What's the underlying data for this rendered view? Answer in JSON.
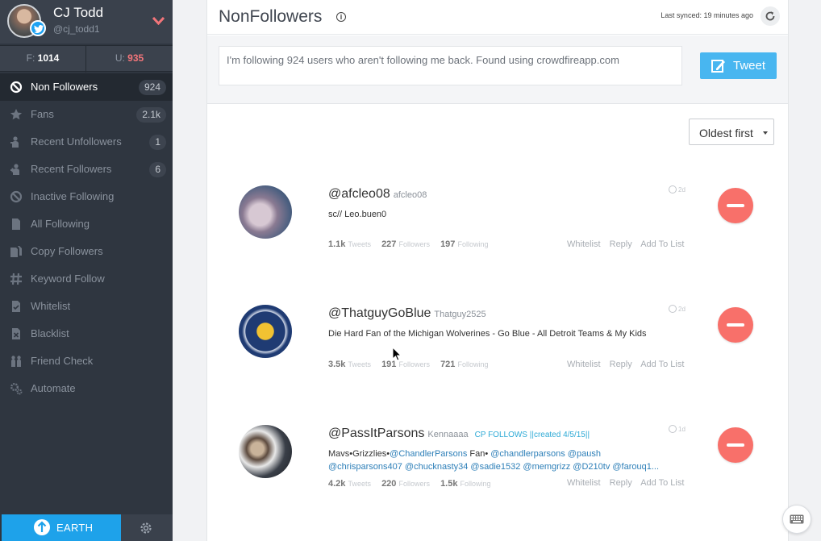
{
  "profile": {
    "name": "CJ Todd",
    "handle": "@cj_todd1"
  },
  "stats": {
    "followers_key": "F:",
    "followers_value": "1014",
    "unfollowers_key": "U:",
    "unfollowers_value": "935"
  },
  "nav": [
    {
      "label": "Non Followers",
      "count": "924",
      "icon": "block-icon"
    },
    {
      "label": "Fans",
      "count": "2.1k",
      "icon": "star-icon"
    },
    {
      "label": "Recent Unfollowers",
      "count": "1",
      "icon": "user-minus-icon"
    },
    {
      "label": "Recent Followers",
      "count": "6",
      "icon": "user-plus-icon"
    },
    {
      "label": "Inactive Following",
      "count": "",
      "icon": "block-icon"
    },
    {
      "label": "All Following",
      "count": "",
      "icon": "document-icon"
    },
    {
      "label": "Copy Followers",
      "count": "",
      "icon": "copy-icon"
    },
    {
      "label": "Keyword Follow",
      "count": "",
      "icon": "hashtag-icon"
    },
    {
      "label": "Whitelist",
      "count": "",
      "icon": "check-document-icon"
    },
    {
      "label": "Blacklist",
      "count": "",
      "icon": "x-document-icon"
    },
    {
      "label": "Friend Check",
      "count": "",
      "icon": "friends-icon"
    },
    {
      "label": "Automate",
      "count": "",
      "icon": "gears-icon"
    }
  ],
  "footer": {
    "earth_label": "EARTH"
  },
  "header": {
    "title": "NonFollowers",
    "sync_text": "Last synced: 19 minutes ago"
  },
  "compose": {
    "text": "I'm following 924 users who aren't following me back. Found using crowdfireapp.com",
    "tweet_label": "Tweet"
  },
  "sort": {
    "selected": "Oldest first"
  },
  "metric_labels": {
    "tweets": "Tweets",
    "followers": "Followers",
    "following": "Following"
  },
  "actions": {
    "whitelist": "Whitelist",
    "reply": "Reply",
    "add_to_list": "Add To List"
  },
  "users": [
    {
      "handle": "@afcleo08",
      "name": "afcleo08",
      "tag": "",
      "time": "2d",
      "bio": "sc// Leo.buen0",
      "bio2": "",
      "tweets": "1.1k",
      "followers": "227",
      "following": "197"
    },
    {
      "handle": "@ThatguyGoBlue",
      "name": "Thatguy2525",
      "tag": "",
      "time": "2d",
      "bio": "Die Hard Fan of the Michigan Wolverines - Go Blue - All Detroit Teams & My Kids",
      "bio2": "",
      "tweets": "3.5k",
      "followers": "191",
      "following": "721"
    },
    {
      "handle": "@PassItParsons",
      "name": "Kennaaaa",
      "tag": "CP FOLLOWS ||created 4/5/15||",
      "time": "1d",
      "bio_prefix": "Mavs•Grizzlies•",
      "bio_m1": "@ChandlerParsons",
      "bio_mid": " Fan• ",
      "bio_m2": "@chandlerparsons @paush",
      "bio2": "@chrisparsons407 @chucknasty34 @sadie1532 @memgrizz @D210tv @farouq1...",
      "tweets": "4.2k",
      "followers": "220",
      "following": "1.5k"
    }
  ],
  "colors": {
    "sidebar": "#2f3640",
    "accent": "#1ea2ea",
    "unfollow": "#f8706a",
    "tweet": "#48b6f0"
  }
}
